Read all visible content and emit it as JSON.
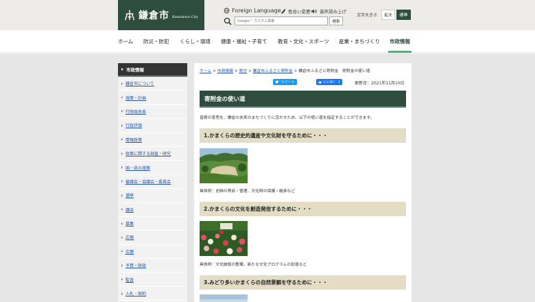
{
  "header": {
    "logo_name": "鎌倉市",
    "logo_sub": "Kamakura City",
    "foreign_language": "Foreign Language",
    "color_change": "色合い変更",
    "voice_read": "音声読み上げ",
    "search_placeholder": "Google™ カスタム検索",
    "search_button": "検索",
    "font_size_label": "文字大きさ",
    "font_large": "拡大",
    "font_standard": "標準"
  },
  "nav": {
    "items": [
      "ホーム",
      "防災・防犯",
      "くらし・環境",
      "健康・福祉・子育て",
      "教育・文化・スポーツ",
      "産業・まちづくり",
      "市政情報"
    ],
    "active": "市政情報"
  },
  "sidebar": {
    "heading": "市政情報",
    "items": [
      "鎌倉市について",
      "施策・計画",
      "行財政改革",
      "行政評価",
      "情報政策",
      "政策に関する調査・研究",
      "国・県の施策",
      "審議会・協議会・委員会",
      "選挙",
      "議会",
      "募集",
      "広報",
      "広聴",
      "予算・財政",
      "監査",
      "入札・契約"
    ]
  },
  "breadcrumb": {
    "links": [
      "ホーム",
      "市政情報",
      "寄付",
      "鎌倉市ふるさと寄附金"
    ],
    "current": "鎌倉市ふるさと寄附金　寄附金の使い道",
    "separator": ">"
  },
  "share": {
    "tweet": "ツイート",
    "like": "いいね！ 1",
    "updated": "更新日：2021年11月10日"
  },
  "article": {
    "title": "寄附金の使い道",
    "intro": "皆様の意思を、鎌倉の未来のまちづくりに活かすため、以下の使い道を指定することができます。",
    "sections": [
      {
        "heading": "1.かまくらの歴史的遺産や文化財を守るために・・・",
        "caption": "具体例：史跡の買収・管理、文化財の保護・継承など"
      },
      {
        "heading": "2.かまくらの文化を創造発信するために・・・",
        "caption": "具体例：文化施設の整備、新たな文化プログラムの創造など"
      },
      {
        "heading": "3.みどり多いかまくらの自然景観を守るために・・・",
        "caption": ""
      }
    ]
  },
  "colors": {
    "brand": "#2f4d3f",
    "section_bg": "#e4ddc6",
    "link": "#2255aa"
  }
}
